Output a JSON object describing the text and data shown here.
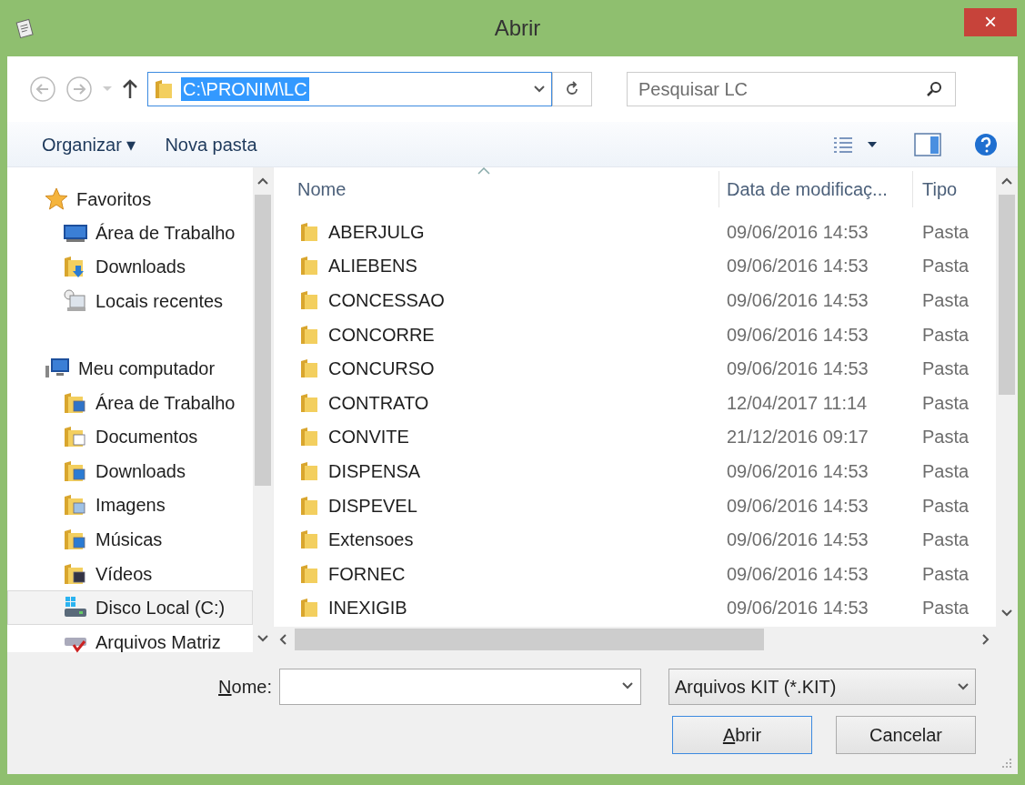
{
  "window": {
    "title": "Abrir"
  },
  "address": {
    "path": "C:\\PRONIM\\LC"
  },
  "search": {
    "placeholder": "Pesquisar LC"
  },
  "toolbar": {
    "items": [
      "Organizar ▾",
      "Nova pasta"
    ]
  },
  "sidebar": {
    "groups": [
      {
        "label": "Favoritos",
        "children": [
          {
            "label": "Área de Trabalho",
            "selected": false
          },
          {
            "label": "Downloads",
            "selected": false
          },
          {
            "label": "Locais recentes",
            "selected": false
          }
        ]
      },
      {
        "label": "Meu computador",
        "children": [
          {
            "label": "Área de Trabalho",
            "selected": false
          },
          {
            "label": "Documentos",
            "selected": false
          },
          {
            "label": "Downloads",
            "selected": false
          },
          {
            "label": "Imagens",
            "selected": false
          },
          {
            "label": "Músicas",
            "selected": false
          },
          {
            "label": "Vídeos",
            "selected": false
          },
          {
            "label": "Disco Local (C:)",
            "selected": true
          },
          {
            "label": "Arquivos Matriz",
            "selected": false
          }
        ]
      }
    ]
  },
  "table": {
    "columns": [
      "Nome",
      "Data de modificaç...",
      "Tipo"
    ],
    "rows": [
      {
        "name": "ABERJULG",
        "date": "09/06/2016 14:53",
        "type": "Pasta"
      },
      {
        "name": "ALIEBENS",
        "date": "09/06/2016 14:53",
        "type": "Pasta"
      },
      {
        "name": "CONCESSAO",
        "date": "09/06/2016 14:53",
        "type": "Pasta"
      },
      {
        "name": "CONCORRE",
        "date": "09/06/2016 14:53",
        "type": "Pasta"
      },
      {
        "name": "CONCURSO",
        "date": "09/06/2016 14:53",
        "type": "Pasta"
      },
      {
        "name": "CONTRATO",
        "date": "12/04/2017 11:14",
        "type": "Pasta"
      },
      {
        "name": "CONVITE",
        "date": "21/12/2016 09:17",
        "type": "Pasta"
      },
      {
        "name": "DISPENSA",
        "date": "09/06/2016 14:53",
        "type": "Pasta"
      },
      {
        "name": "DISPEVEL",
        "date": "09/06/2016 14:53",
        "type": "Pasta"
      },
      {
        "name": "Extensoes",
        "date": "09/06/2016 14:53",
        "type": "Pasta"
      },
      {
        "name": "FORNEC",
        "date": "09/06/2016 14:53",
        "type": "Pasta"
      },
      {
        "name": "INEXIGIB",
        "date": "09/06/2016 14:53",
        "type": "Pasta"
      }
    ]
  },
  "filename": {
    "label": "Nome:"
  },
  "filetype": {
    "value": "Arquivos KIT (*.KIT)"
  },
  "buttons": [
    "Abrir",
    "Cancelar"
  ],
  "close_button": "×"
}
